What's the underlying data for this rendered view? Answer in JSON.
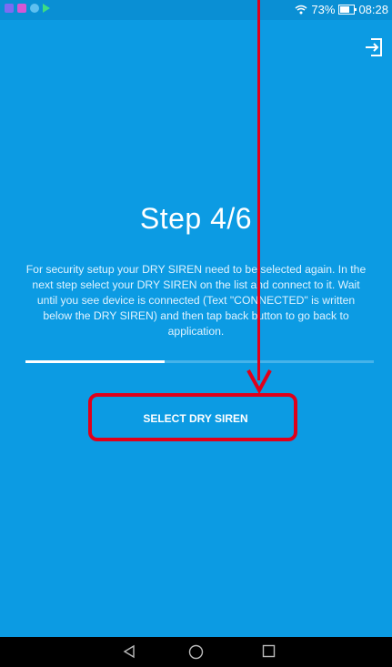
{
  "status_bar": {
    "battery_percent": "73%",
    "time": "08:28",
    "notification_icons": [
      "gallery-icon",
      "app-icon",
      "chat-icon",
      "play-store-icon"
    ],
    "colors": {
      "gallery": "#7c6cf2",
      "app": "#d657d4",
      "chat": "#5ec0f0",
      "play": "#3ddc84"
    }
  },
  "header": {
    "exit_icon": "exit-icon"
  },
  "main": {
    "step_title": "Step 4/6",
    "instructions": "For security setup your DRY SIREN need to be selected again. In the next step select your DRY SIREN on the list and connect to it. Wait until you see device is connected (Text \"CONNECTED\" is written below the DRY SIREN) and then tap back button to go back to application.",
    "progress": {
      "current_step": 4,
      "total_steps": 6,
      "fraction": 0.4
    },
    "select_button_label": "SELECT DRY SIREN"
  },
  "nav_bar": {
    "icons": [
      "back-icon",
      "home-icon",
      "recents-icon"
    ]
  },
  "colors": {
    "background": "#0c9be3",
    "annotation": "#e0001a"
  }
}
